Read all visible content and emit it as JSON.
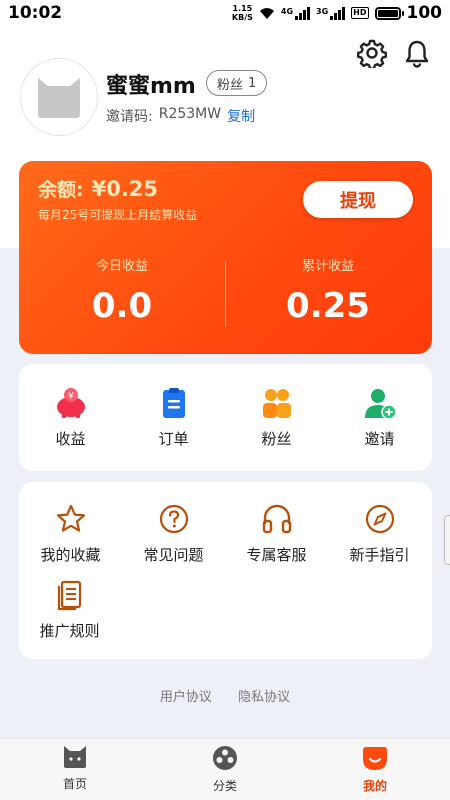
{
  "status_bar": {
    "time": "10:02",
    "net_speed_value": "1.15",
    "net_speed_unit": "KB/S",
    "sim1_label": "4G",
    "sim2_label": "3G",
    "hd_label": "HD",
    "battery_percent": "100"
  },
  "profile": {
    "username": "蜜蜜mm",
    "fans_label": "粉丝",
    "fans_count": "1",
    "invite_label": "邀请码:",
    "invite_code": "R253MW",
    "copy_label": "复制"
  },
  "balance": {
    "label": "余额:",
    "amount": "¥0.25",
    "note": "每月25号可提现上月结算收益",
    "withdraw_label": "提现",
    "today_label": "今日收益",
    "today_value": "0.0",
    "total_label": "累计收益",
    "total_value": "0.25"
  },
  "quick_menu": [
    {
      "label": "收益",
      "icon": "piggy-bank-icon"
    },
    {
      "label": "订单",
      "icon": "clipboard-icon"
    },
    {
      "label": "粉丝",
      "icon": "fans-icon"
    },
    {
      "label": "邀请",
      "icon": "invite-user-icon"
    }
  ],
  "services": [
    {
      "label": "我的收藏",
      "icon": "star-icon"
    },
    {
      "label": "常见问题",
      "icon": "question-icon"
    },
    {
      "label": "专属客服",
      "icon": "headset-icon"
    },
    {
      "label": "新手指引",
      "icon": "compass-icon"
    },
    {
      "label": "推广规则",
      "icon": "document-icon"
    }
  ],
  "footer_links": [
    "用户协议",
    "隐私协议"
  ],
  "bottom_nav": [
    {
      "label": "首页",
      "icon": "home-cat-icon",
      "active": false
    },
    {
      "label": "分类",
      "icon": "category-icon",
      "active": false
    },
    {
      "label": "我的",
      "icon": "mine-icon",
      "active": true
    }
  ],
  "colors": {
    "accent": "#ff4a0f",
    "balance_text": "#ffe7b8",
    "service_icon": "#b8500a",
    "link_blue": "#1d6fd6",
    "nav_active": "#e8420c"
  }
}
